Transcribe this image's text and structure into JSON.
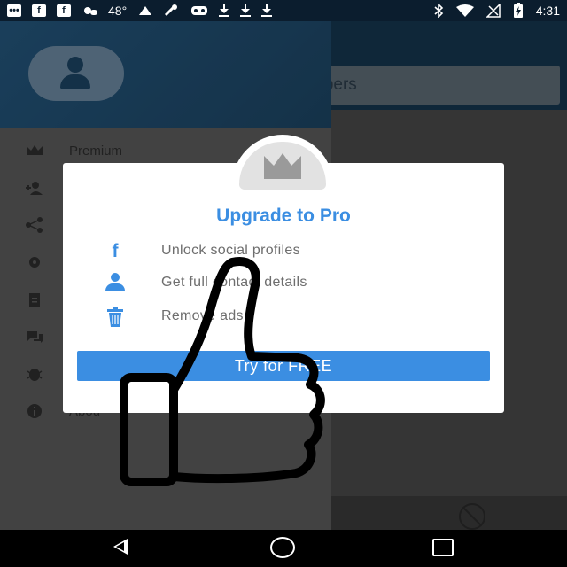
{
  "status_bar": {
    "temperature": "48°",
    "time": "4:31",
    "left_icons": [
      "message-icon",
      "facebook-icon",
      "facebook-icon",
      "weather-icon",
      "temperature-text",
      "app-icon",
      "wrench-icon",
      "gamepad-icon",
      "download-icon",
      "download-icon",
      "download-icon"
    ],
    "right_icons": [
      "bluetooth-icon",
      "wifi-icon",
      "no-signal-icon",
      "battery-charging-icon"
    ]
  },
  "app": {
    "search_placeholder": "mbers"
  },
  "drawer": {
    "items": [
      {
        "icon": "crown-icon",
        "label": "Premium"
      },
      {
        "icon": "add-group-icon",
        "label": ""
      },
      {
        "icon": "share-icon",
        "label": ""
      },
      {
        "icon": "gear-icon",
        "label": ""
      },
      {
        "icon": "clipboard-icon",
        "label": ""
      },
      {
        "icon": "chat-icon",
        "label": ""
      },
      {
        "icon": "bug-icon",
        "label": ""
      },
      {
        "icon": "info-icon",
        "label": "Abou"
      }
    ]
  },
  "dialog": {
    "title": "Upgrade to Pro",
    "features": [
      {
        "icon": "facebook-icon",
        "label": "Unlock social profiles"
      },
      {
        "icon": "person-icon",
        "label": "Get full contact details"
      },
      {
        "icon": "trash-icon",
        "label": "Remove ads"
      }
    ],
    "cta_label": "Try for FREE",
    "accent_color": "#3b8ee2"
  },
  "overlay": {
    "icon": "thumbs-up-drawing"
  },
  "nav_bar": {
    "icons": [
      "back-icon",
      "home-icon",
      "recents-icon"
    ]
  }
}
